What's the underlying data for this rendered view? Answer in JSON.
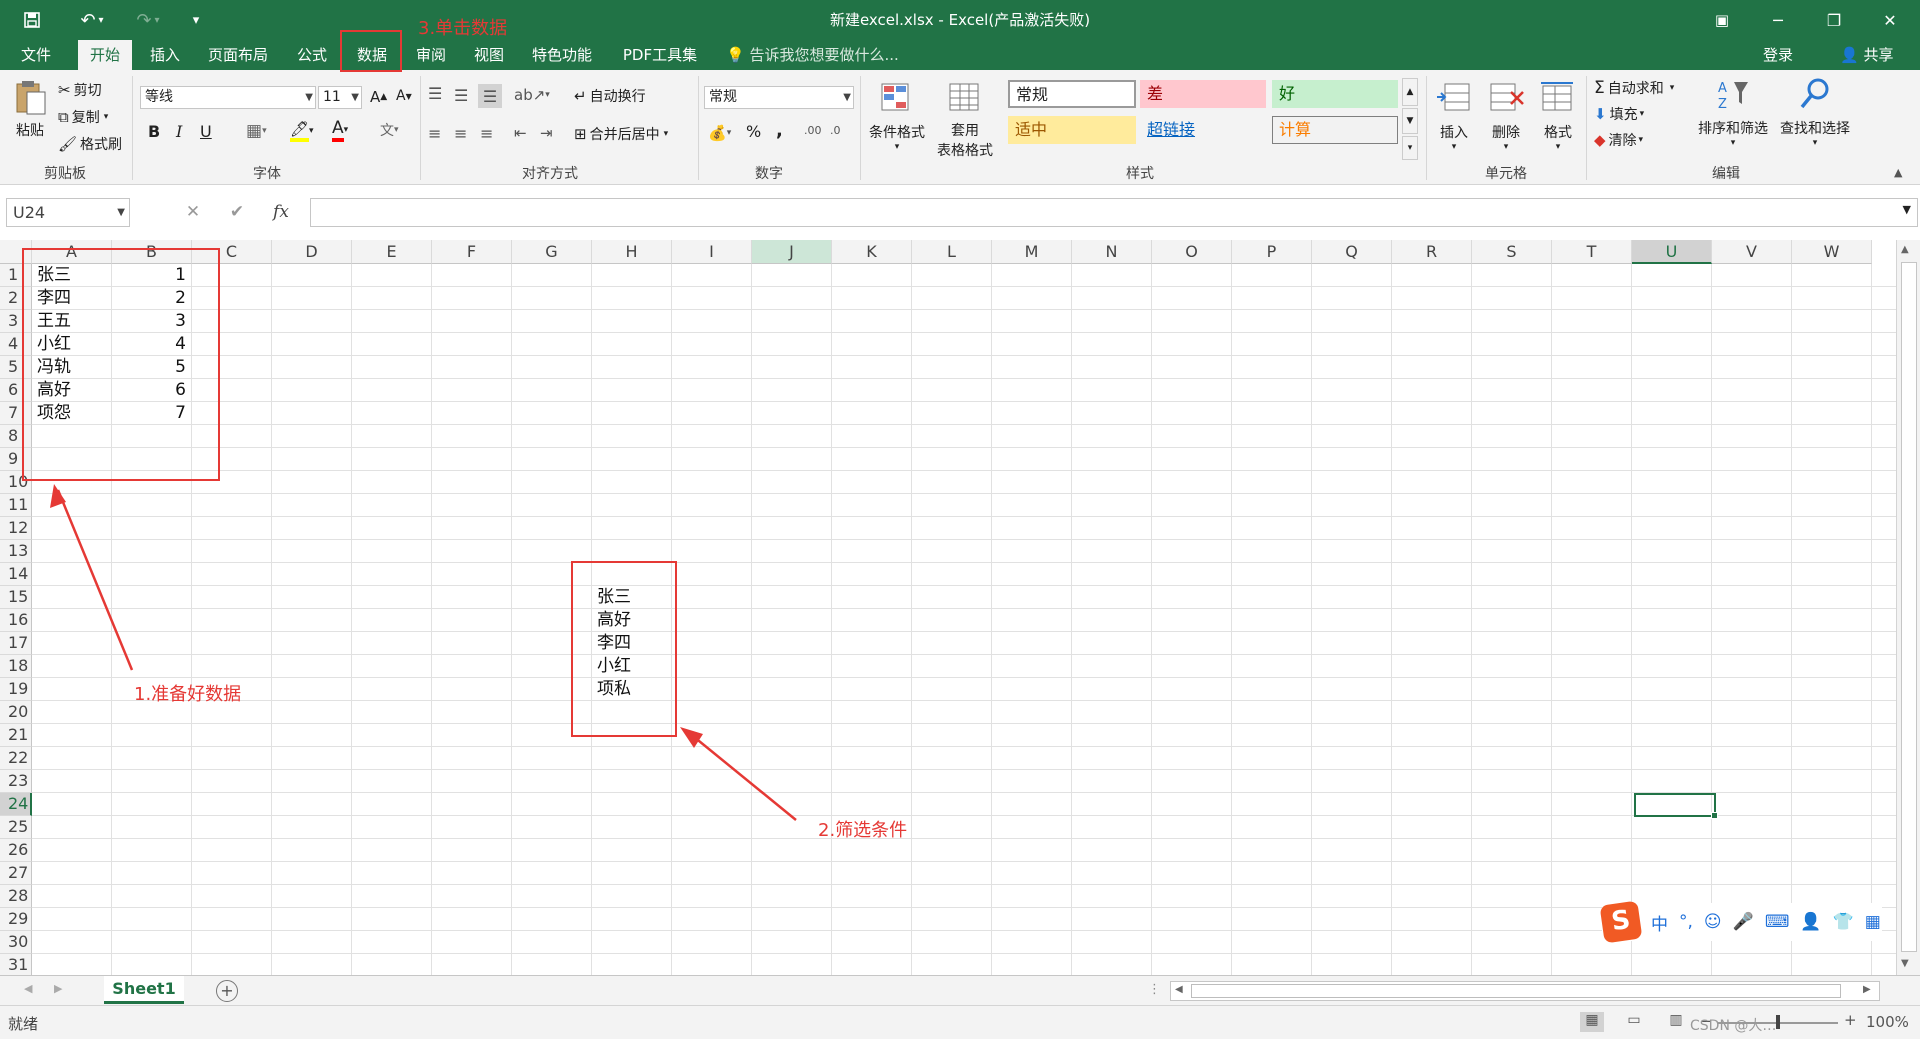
{
  "window": {
    "title": "新建excel.xlsx - Excel(产品激活失败)",
    "min_glyph": "─",
    "restore_glyph": "❐",
    "close_glyph": "✕",
    "ribbon_toggle_glyph": "▣"
  },
  "quick_access": {
    "save_glyph": "🖫",
    "undo_glyph": "↶",
    "redo_glyph": "↷",
    "custom_glyph": "▾"
  },
  "tabs": [
    "文件",
    "开始",
    "插入",
    "页面布局",
    "公式",
    "数据",
    "审阅",
    "视图",
    "特色功能",
    "PDF工具集"
  ],
  "active_tab": "开始",
  "tellme": "告诉我您想要做什么...",
  "account": {
    "login": "登录",
    "share": "共享"
  },
  "ribbon": {
    "clipboard": {
      "label": "剪贴板",
      "paste": "粘贴",
      "cut": "剪切",
      "copy": "复制",
      "format_painter": "格式刷"
    },
    "font": {
      "label": "字体",
      "family": "等线",
      "size": "11",
      "bold": "B",
      "italic": "I",
      "underline": "U"
    },
    "alignment": {
      "label": "对齐方式",
      "wrap": "自动换行",
      "merge": "合并后居中"
    },
    "number": {
      "label": "数字",
      "format": "常规",
      "percent": "%",
      "comma": ","
    },
    "styles": {
      "label": "样式",
      "cond_format": "条件格式",
      "table_format_1": "套用",
      "table_format_2": "表格格式",
      "cells": [
        {
          "name": "常规",
          "bg": "#ffffff",
          "fg": "#000000"
        },
        {
          "name": "差",
          "bg": "#ffc7ce",
          "fg": "#9c0006"
        },
        {
          "name": "好",
          "bg": "#c6efce",
          "fg": "#006100"
        },
        {
          "name": "适中",
          "bg": "#ffeb9c",
          "fg": "#9c5700"
        },
        {
          "name": "超链接",
          "bg": "#f3f3f3",
          "fg": "#0563c1"
        },
        {
          "name": "计算",
          "bg": "#f2f2f2",
          "fg": "#fa7d00"
        }
      ]
    },
    "cells_group": {
      "label": "单元格",
      "insert": "插入",
      "delete": "删除",
      "format": "格式"
    },
    "editing": {
      "label": "编辑",
      "autosum": "自动求和",
      "fill": "填充",
      "clear": "清除",
      "sort_filter": "排序和筛选",
      "find_select": "查找和选择"
    }
  },
  "formula_bar": {
    "name_box": "U24",
    "cancel_glyph": "✕",
    "enter_glyph": "✔",
    "fx": "fx",
    "value": ""
  },
  "columns": [
    "A",
    "B",
    "C",
    "D",
    "E",
    "F",
    "G",
    "H",
    "I",
    "J",
    "K",
    "L",
    "M",
    "N",
    "O",
    "P",
    "Q",
    "R",
    "S",
    "T",
    "U",
    "V",
    "W"
  ],
  "selected_col": "U",
  "highlight_col": "J",
  "selected_row": 24,
  "row_count": 31,
  "data_table": [
    {
      "name": "张三",
      "value": "1"
    },
    {
      "name": "李四",
      "value": "2"
    },
    {
      "name": "王五",
      "value": "3"
    },
    {
      "name": "小红",
      "value": "4"
    },
    {
      "name": "冯轨",
      "value": "5"
    },
    {
      "name": "高好",
      "value": "6"
    },
    {
      "name": "项怨",
      "value": "7"
    }
  ],
  "criteria": [
    "张三",
    "高好",
    "李四",
    "小红",
    "项私"
  ],
  "annotations": {
    "step1": "1.准备好数据",
    "step2": "2.筛选条件",
    "step3": "3.单击数据"
  },
  "sheets": [
    "Sheet1"
  ],
  "status": {
    "ready": "就绪",
    "zoom": "100%",
    "watermark": "CSDN @大…"
  },
  "ime": {
    "items": [
      "中",
      "°,",
      "☺",
      "🎤",
      "⌨",
      "👤",
      "👕",
      "▦"
    ]
  },
  "colors": {
    "excel_green": "#217346",
    "annotation_red": "#e53935"
  }
}
